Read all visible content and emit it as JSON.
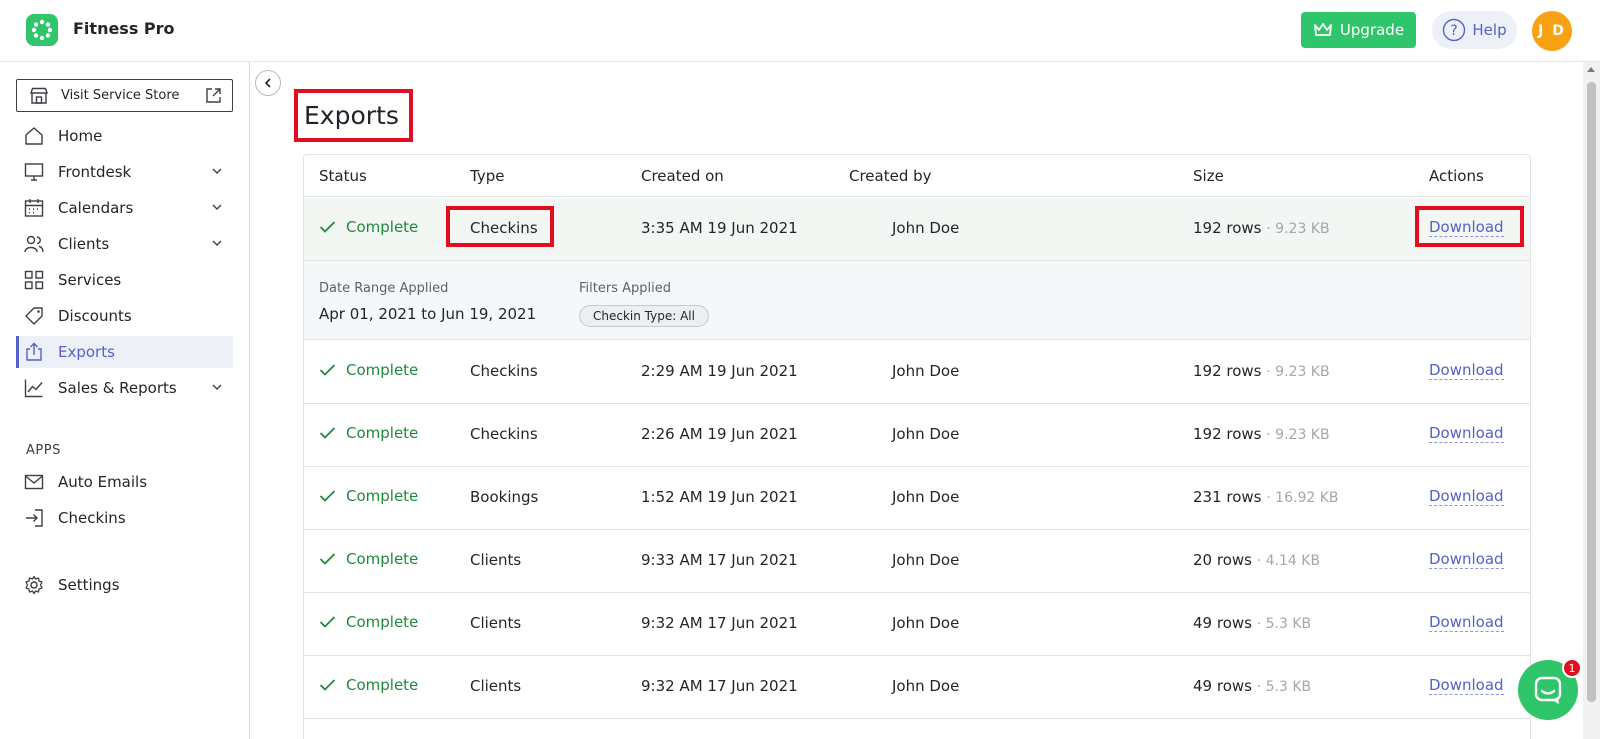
{
  "app": {
    "title": "Fitness Pro",
    "upgrade_label": "Upgrade",
    "help_label": "Help",
    "avatar_initials": "J D",
    "brand_color": "#2fc56b",
    "accent_color": "#5560c9"
  },
  "sidebar": {
    "store_label": "Visit Service Store",
    "items": [
      {
        "label": "Home",
        "icon": "home-icon",
        "expandable": false
      },
      {
        "label": "Frontdesk",
        "icon": "monitor-icon",
        "expandable": true
      },
      {
        "label": "Calendars",
        "icon": "calendar-icon",
        "expandable": true
      },
      {
        "label": "Clients",
        "icon": "users-icon",
        "expandable": true
      },
      {
        "label": "Services",
        "icon": "grid-icon",
        "expandable": false
      },
      {
        "label": "Discounts",
        "icon": "tag-icon",
        "expandable": false
      },
      {
        "label": "Exports",
        "icon": "export-icon",
        "expandable": false,
        "active": true
      },
      {
        "label": "Sales & Reports",
        "icon": "chart-icon",
        "expandable": true
      }
    ],
    "apps_section_label": "APPS",
    "apps": [
      {
        "label": "Auto Emails",
        "icon": "mail-icon"
      },
      {
        "label": "Checkins",
        "icon": "sign-in-icon"
      }
    ],
    "settings_label": "Settings"
  },
  "main": {
    "title": "Exports",
    "columns": [
      "Status",
      "Type",
      "Created on",
      "Created by",
      "Size",
      "Actions"
    ],
    "rows": [
      {
        "status": "Complete",
        "type": "Checkins",
        "created_on": "3:35 AM 19 Jun 2021",
        "created_by": "John Doe",
        "rows": "192 rows",
        "size": "· 9.23 KB",
        "action": "Download"
      },
      {
        "status": "Complete",
        "type": "Checkins",
        "created_on": "2:29 AM 19 Jun 2021",
        "created_by": "John Doe",
        "rows": "192 rows",
        "size": "· 9.23 KB",
        "action": "Download"
      },
      {
        "status": "Complete",
        "type": "Checkins",
        "created_on": "2:26 AM 19 Jun 2021",
        "created_by": "John Doe",
        "rows": "192 rows",
        "size": "· 9.23 KB",
        "action": "Download"
      },
      {
        "status": "Complete",
        "type": "Bookings",
        "created_on": "1:52 AM 19 Jun 2021",
        "created_by": "John Doe",
        "rows": "231 rows",
        "size": "· 16.92 KB",
        "action": "Download"
      },
      {
        "status": "Complete",
        "type": "Clients",
        "created_on": "9:33 AM 17 Jun 2021",
        "created_by": "John Doe",
        "rows": "20 rows",
        "size": "· 4.14 KB",
        "action": "Download"
      },
      {
        "status": "Complete",
        "type": "Clients",
        "created_on": "9:32 AM 17 Jun 2021",
        "created_by": "John Doe",
        "rows": "49 rows",
        "size": "· 5.3 KB",
        "action": "Download"
      },
      {
        "status": "Complete",
        "type": "Clients",
        "created_on": "9:32 AM 17 Jun 2021",
        "created_by": "John Doe",
        "rows": "49 rows",
        "size": "· 5.3 KB",
        "action": "Download"
      }
    ],
    "detail": {
      "date_range_label": "Date Range Applied",
      "date_range_value": "Apr 01, 2021 to Jun 19, 2021",
      "filters_label": "Filters Applied",
      "filter_chip": "Checkin Type: All"
    }
  },
  "chat": {
    "badge_count": "1"
  }
}
